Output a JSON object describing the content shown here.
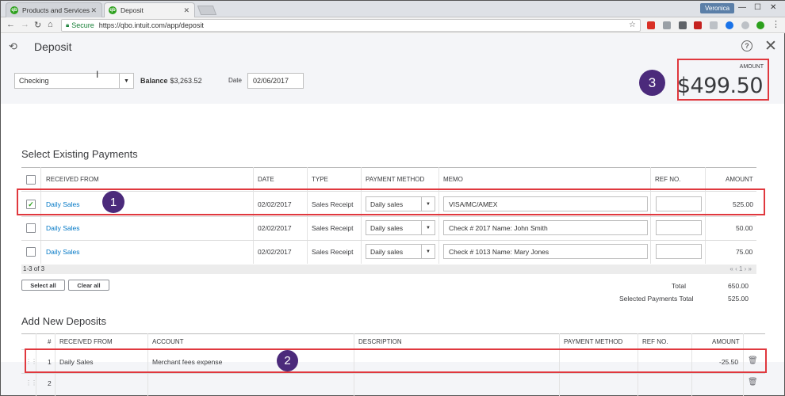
{
  "browser": {
    "tabs": [
      {
        "label": "Products and Services",
        "active": false
      },
      {
        "label": "Deposit",
        "active": true
      }
    ],
    "profile_name": "Veronica",
    "secure_label": "Secure",
    "url": "https://qbo.intuit.com/app/deposit"
  },
  "page": {
    "title": "Deposit",
    "account": "Checking",
    "balance_label": "Balance",
    "balance_value": "$3,263.52",
    "date_label": "Date",
    "date_value": "02/06/2017",
    "amount_label": "AMOUNT",
    "amount_value": "$499.50"
  },
  "annotations": [
    "1",
    "2",
    "3"
  ],
  "existing": {
    "title": "Select Existing Payments",
    "columns": [
      "RECEIVED FROM",
      "DATE",
      "TYPE",
      "PAYMENT METHOD",
      "MEMO",
      "REF NO.",
      "AMOUNT"
    ],
    "rows": [
      {
        "checked": true,
        "received_from": "Daily Sales",
        "date": "02/02/2017",
        "type": "Sales Receipt",
        "payment_method": "Daily sales",
        "memo": "VISA/MC/AMEX",
        "ref_no": "",
        "amount": "525.00"
      },
      {
        "checked": false,
        "received_from": "Daily Sales",
        "date": "02/02/2017",
        "type": "Sales Receipt",
        "payment_method": "Daily sales",
        "memo": "Check # 2017 Name: John Smith",
        "ref_no": "",
        "amount": "50.00"
      },
      {
        "checked": false,
        "received_from": "Daily Sales",
        "date": "02/02/2017",
        "type": "Sales Receipt",
        "payment_method": "Daily sales",
        "memo": "Check # 1013 Name: Mary Jones",
        "ref_no": "",
        "amount": "75.00"
      }
    ],
    "count_text": "1-3 of 3",
    "pager_text": "« ‹ 1 › »",
    "select_all_label": "Select all",
    "clear_all_label": "Clear all",
    "total_label": "Total",
    "total_value": "650.00",
    "selected_total_label": "Selected Payments Total",
    "selected_total_value": "525.00"
  },
  "new_deposits": {
    "title": "Add New Deposits",
    "columns": [
      "#",
      "RECEIVED FROM",
      "ACCOUNT",
      "DESCRIPTION",
      "PAYMENT METHOD",
      "REF NO.",
      "AMOUNT"
    ],
    "rows": [
      {
        "num": "1",
        "received_from": "Daily Sales",
        "account": "Merchant fees expense",
        "description": "",
        "payment_method": "",
        "ref_no": "",
        "amount": "-25.50"
      },
      {
        "num": "2",
        "received_from": "",
        "account": "",
        "description": "",
        "payment_method": "",
        "ref_no": "",
        "amount": ""
      }
    ]
  },
  "colors": {
    "accent_green": "#2ca01c",
    "link_blue": "#0077c5",
    "highlight_red": "#e0383e",
    "badge_purple": "#4b2a7b"
  }
}
